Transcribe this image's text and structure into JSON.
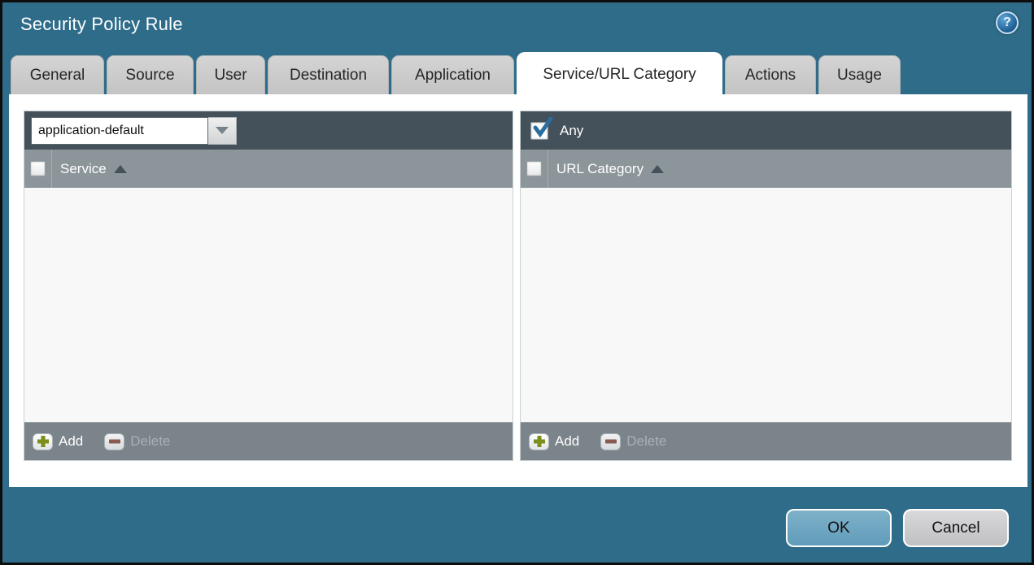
{
  "window": {
    "title": "Security Policy Rule",
    "help_icon": "question-mark"
  },
  "tabs": [
    {
      "label": "General",
      "active": false
    },
    {
      "label": "Source",
      "active": false
    },
    {
      "label": "User",
      "active": false
    },
    {
      "label": "Destination",
      "active": false
    },
    {
      "label": "Application",
      "active": false
    },
    {
      "label": "Service/URL Category",
      "active": true
    },
    {
      "label": "Actions",
      "active": false
    },
    {
      "label": "Usage",
      "active": false
    }
  ],
  "service_panel": {
    "dropdown": {
      "value": "application-default"
    },
    "column_header": {
      "label": "Service",
      "sort": "ascending"
    },
    "rows": [],
    "select_all_checked": false,
    "actions": {
      "add_label": "Add",
      "delete_label": "Delete",
      "delete_enabled": false
    }
  },
  "url_category_panel": {
    "any_checkbox": {
      "label": "Any",
      "checked": true
    },
    "column_header": {
      "label": "URL Category",
      "sort": "ascending"
    },
    "rows": [],
    "select_all_checked": false,
    "actions": {
      "add_label": "Add",
      "delete_label": "Delete",
      "delete_enabled": false
    }
  },
  "footer": {
    "ok_label": "OK",
    "cancel_label": "Cancel"
  },
  "colors": {
    "window_teal": "#2e6c89",
    "tab_inactive": "#c9c9c9",
    "tab_active": "#ffffff",
    "panel_header_dark": "#44515a",
    "column_header_gray": "#8c959a",
    "actions_bar_gray": "#7b848b",
    "panel_body": "#f8f8f8",
    "ok_button": "#68a2be",
    "cancel_button": "#c9c9cb",
    "add_plus_green": "#7c8e1b",
    "delete_minus_red": "#8a564a",
    "checkmark_blue": "#2a6da0"
  }
}
